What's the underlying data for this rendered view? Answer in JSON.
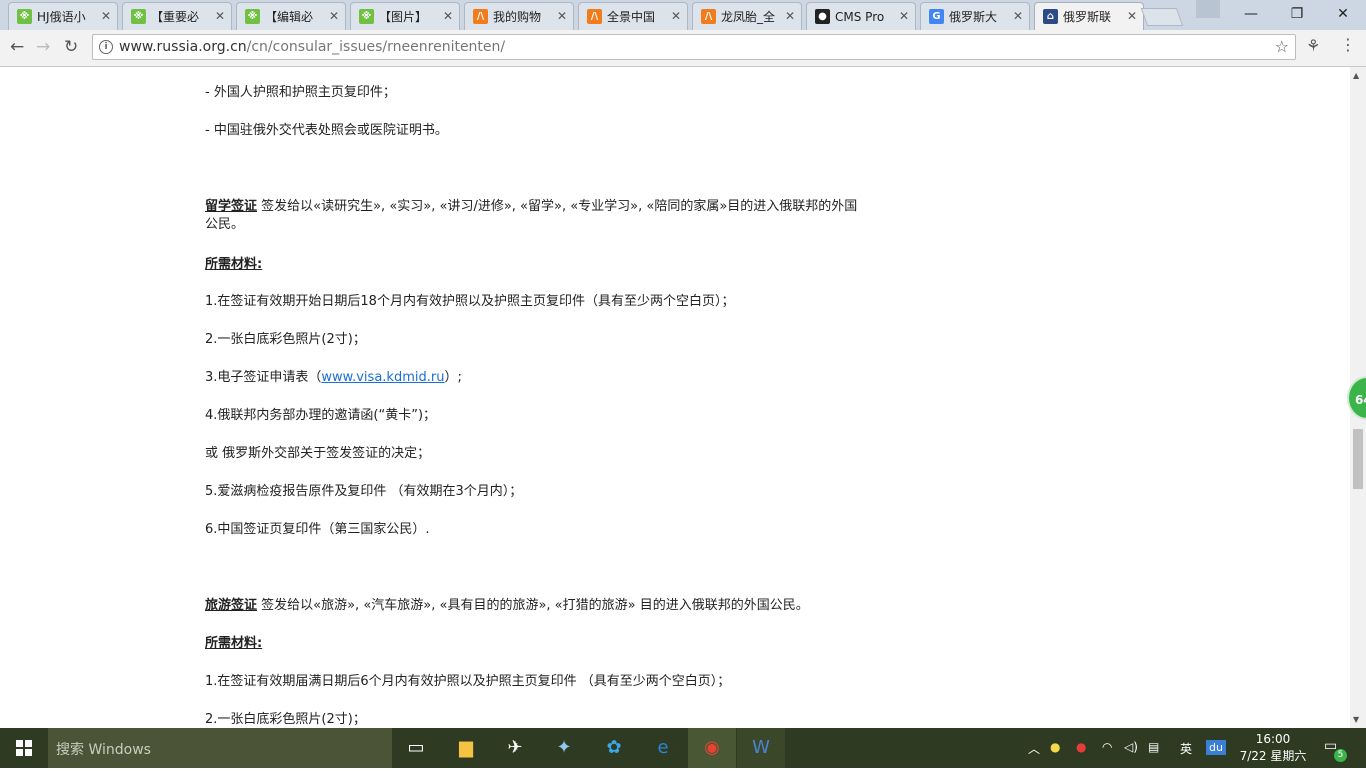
{
  "browser": {
    "tabs": [
      {
        "title": "HJ俄语小",
        "favicon": "hj-icon",
        "color": "#6fc043",
        "glyph": "※"
      },
      {
        "title": "【重要必",
        "favicon": "hj-icon",
        "color": "#6fc043",
        "glyph": "※"
      },
      {
        "title": "【编辑必",
        "favicon": "hj-icon",
        "color": "#6fc043",
        "glyph": "※"
      },
      {
        "title": "【图片】",
        "favicon": "hj-icon",
        "color": "#6fc043",
        "glyph": "※"
      },
      {
        "title": "我的购物",
        "favicon": "taobao-icon",
        "color": "#f27b1c",
        "glyph": "/\\"
      },
      {
        "title": "全景中国",
        "favicon": "taobao-icon",
        "color": "#f27b1c",
        "glyph": "/\\"
      },
      {
        "title": "龙凤胎_全",
        "favicon": "taobao-icon",
        "color": "#f27b1c",
        "glyph": "/\\"
      },
      {
        "title": "CMS Pro",
        "favicon": "github-icon",
        "color": "#222222",
        "glyph": "●"
      },
      {
        "title": "俄罗斯大",
        "favicon": "google-icon",
        "color": "#4285f4",
        "glyph": "G"
      },
      {
        "title": "俄罗斯联",
        "favicon": "embassy-icon",
        "color": "#2b4a86",
        "glyph": "⌂"
      }
    ],
    "active_tab": 9,
    "url_host": "www.russia.org.cn",
    "url_path": "/cn/consular_issues/rneenrenitenten/"
  },
  "content": {
    "p1": "- 外国人护照和护照主页复印件；",
    "p2": "- 中国驻俄外交代表处照会或医院证明书。",
    "study_title": "留学签证",
    "study_desc1": " 签发给以«读研究生», «实习», «讲习/进修», «留学», «专业学习», «陪同的家属»目的进入俄联邦的外国",
    "study_desc2": "公民。",
    "req_label": "所需材料:",
    "s1": "1.在签证有效期开始日期后18个月内有效护照以及护照主页复印件（具有至少两个空白页）；",
    "s2": "2.一张白底彩色照片(2寸)；",
    "s3_pre": "3.电子签证申请表（",
    "s3_link": "www.visa.kdmid.ru",
    "s3_post": "）;",
    "s4": "4.俄联邦内务部办理的邀请函(“黄卡”)；",
    "s4b": "或 俄罗斯外交部关于签发签证的决定；",
    "s5": "5.爱滋病检疫报告原件及复印件 （有效期在3个月内）；",
    "s6": "6.中国签证页复印件（第三国家公民）.",
    "tour_title": "旅游签证",
    "tour_desc": " 签发给以«旅游», «汽车旅游», «具有目的的旅游», «打猎的旅游» 目的进入俄联邦的外国公民。",
    "req_label2": "所需材料:",
    "t1": "1.在签证有效期届满日期后6个月内有效护照以及护照主页复印件 （具有至少两个空白页）；",
    "t2": "2.一张白底彩色照片(2寸)；"
  },
  "float_badge": "64",
  "taskbar": {
    "search_placeholder": "搜索 Windows",
    "ime": "英",
    "time": "16:00",
    "date": "7/22 星期六",
    "notifications": "5"
  }
}
